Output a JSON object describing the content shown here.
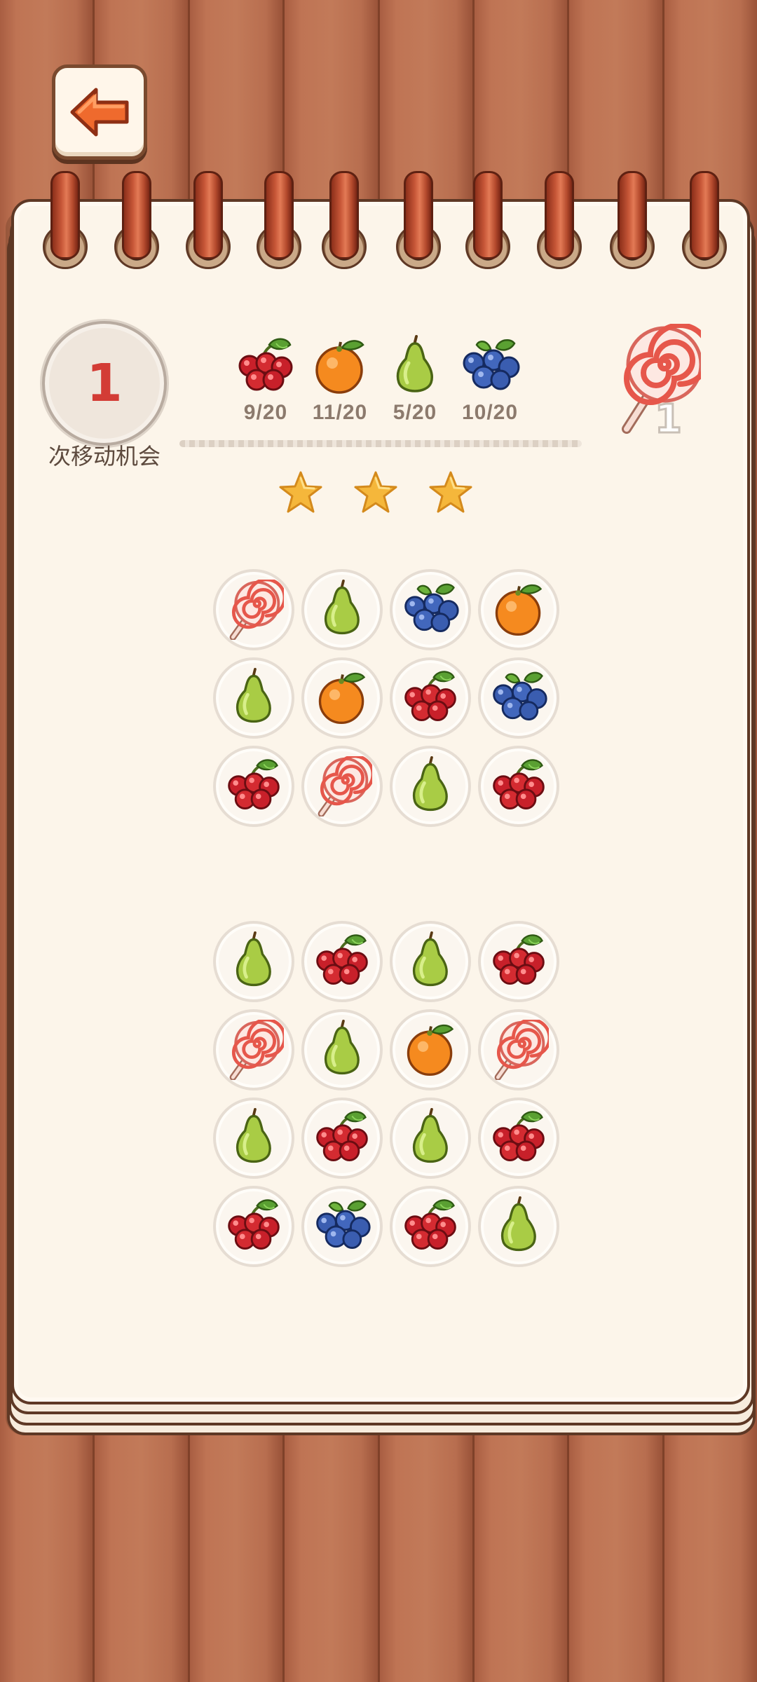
{
  "hud": {
    "moves": "1",
    "moves_label": "次移动机会",
    "booster_count": "1"
  },
  "goals": [
    {
      "fruit": "cherry",
      "count": "9/20"
    },
    {
      "fruit": "orange",
      "count": "11/20"
    },
    {
      "fruit": "pear",
      "count": "5/20"
    },
    {
      "fruit": "blueberry",
      "count": "10/20"
    }
  ],
  "stars_shown": 3,
  "board": {
    "upper": [
      [
        "lollipop",
        "pear",
        "blueberry",
        "orange"
      ],
      [
        "pear",
        "orange",
        "cherry",
        "blueberry"
      ],
      [
        "cherry",
        "lollipop",
        "pear",
        "cherry"
      ]
    ],
    "lower": [
      [
        "pear",
        "cherry",
        "pear",
        "cherry"
      ],
      [
        "lollipop",
        "pear",
        "orange",
        "lollipop"
      ],
      [
        "pear",
        "cherry",
        "pear",
        "cherry"
      ],
      [
        "cherry",
        "blueberry",
        "cherry",
        "pear"
      ]
    ]
  },
  "colors": {
    "moves_number": "#d33c35",
    "star": "#f5b73b",
    "wood": "#b8694b"
  }
}
